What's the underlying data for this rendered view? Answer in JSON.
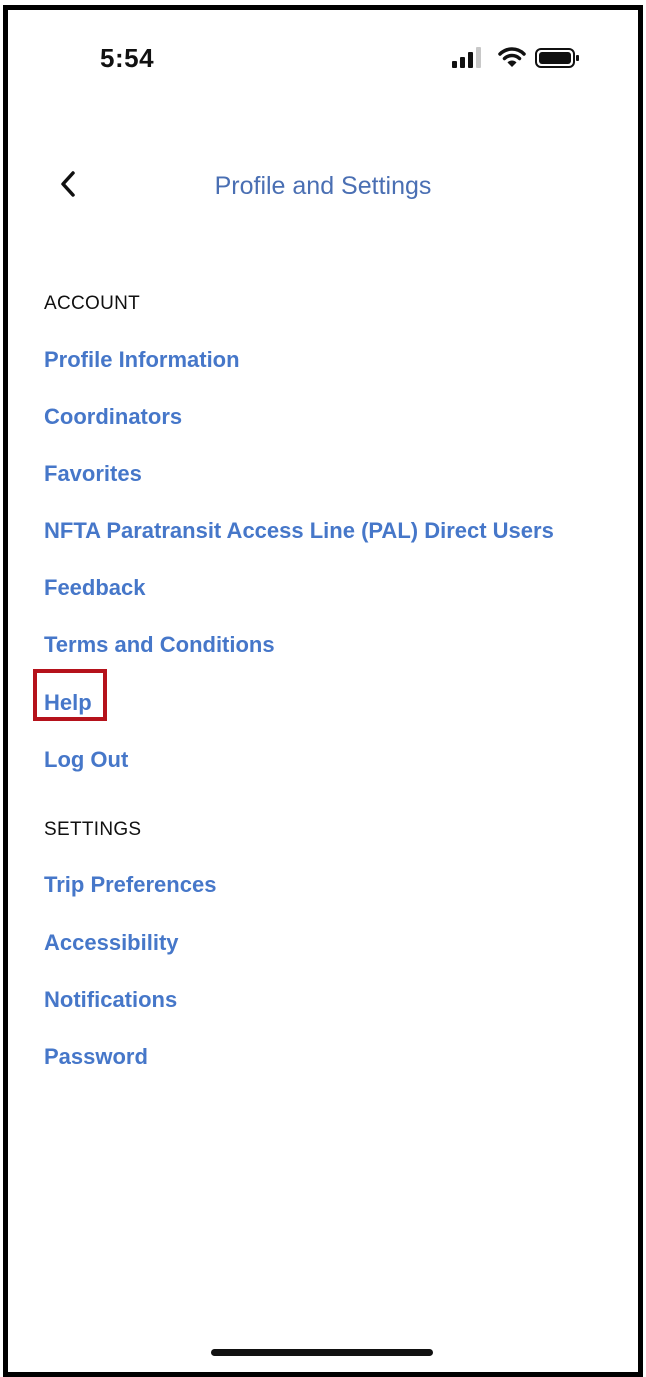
{
  "status_bar": {
    "time": "5:54",
    "icons": [
      "signal-icon",
      "wifi-icon",
      "battery-icon"
    ]
  },
  "nav": {
    "title": "Profile and Settings",
    "back_icon": "chevron-left-icon"
  },
  "account": {
    "header": "ACCOUNT",
    "items": [
      {
        "label": "Profile Information"
      },
      {
        "label": "Coordinators"
      },
      {
        "label": "Favorites"
      },
      {
        "label": "NFTA Paratransit Access Line (PAL) Direct Users"
      },
      {
        "label": "Feedback"
      },
      {
        "label": "Terms and Conditions"
      },
      {
        "label": "Help",
        "highlighted": true
      },
      {
        "label": "Log Out"
      }
    ]
  },
  "settings": {
    "header": "SETTINGS",
    "items": [
      {
        "label": "Trip Preferences"
      },
      {
        "label": "Accessibility"
      },
      {
        "label": "Notifications"
      },
      {
        "label": "Password"
      }
    ]
  },
  "colors": {
    "link": "#4677c9",
    "title": "#4a6fb3",
    "highlight": "#b5121b",
    "text": "#111111"
  }
}
